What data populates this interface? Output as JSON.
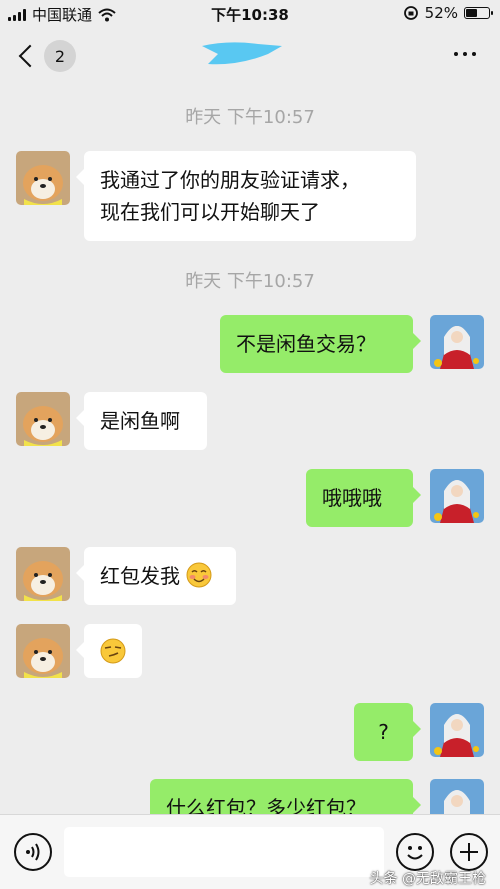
{
  "status_bar": {
    "carrier": "中国联通",
    "time": "下午10:38",
    "battery": "52%",
    "battery_level": 0.52
  },
  "nav": {
    "unread_count": "2"
  },
  "messages": {
    "time_1": "昨天 下午10:57",
    "m1_line1": "我通过了你的朋友验证请求，",
    "m1_line2": "现在我们可以开始聊天了",
    "time_2": "昨天 下午10:57",
    "m2": "不是闲鱼交易？",
    "m3": "是闲鱼啊",
    "m4": "哦哦哦",
    "m5": "红包发我",
    "m7": "?",
    "m8": "什么红包？多少红包？"
  },
  "input": {
    "placeholder": ""
  },
  "watermark": "头条 @无敌霸王枪",
  "icons": {
    "back": "chevron-left-icon",
    "more": "more-dots-icon",
    "voice": "voice-icon",
    "emoji": "emoji-icon",
    "plus": "plus-icon"
  },
  "colors": {
    "background": "#ededed",
    "sent_bubble": "#95ec69",
    "received_bubble": "#ffffff",
    "timestamp": "#a6a6a6"
  }
}
